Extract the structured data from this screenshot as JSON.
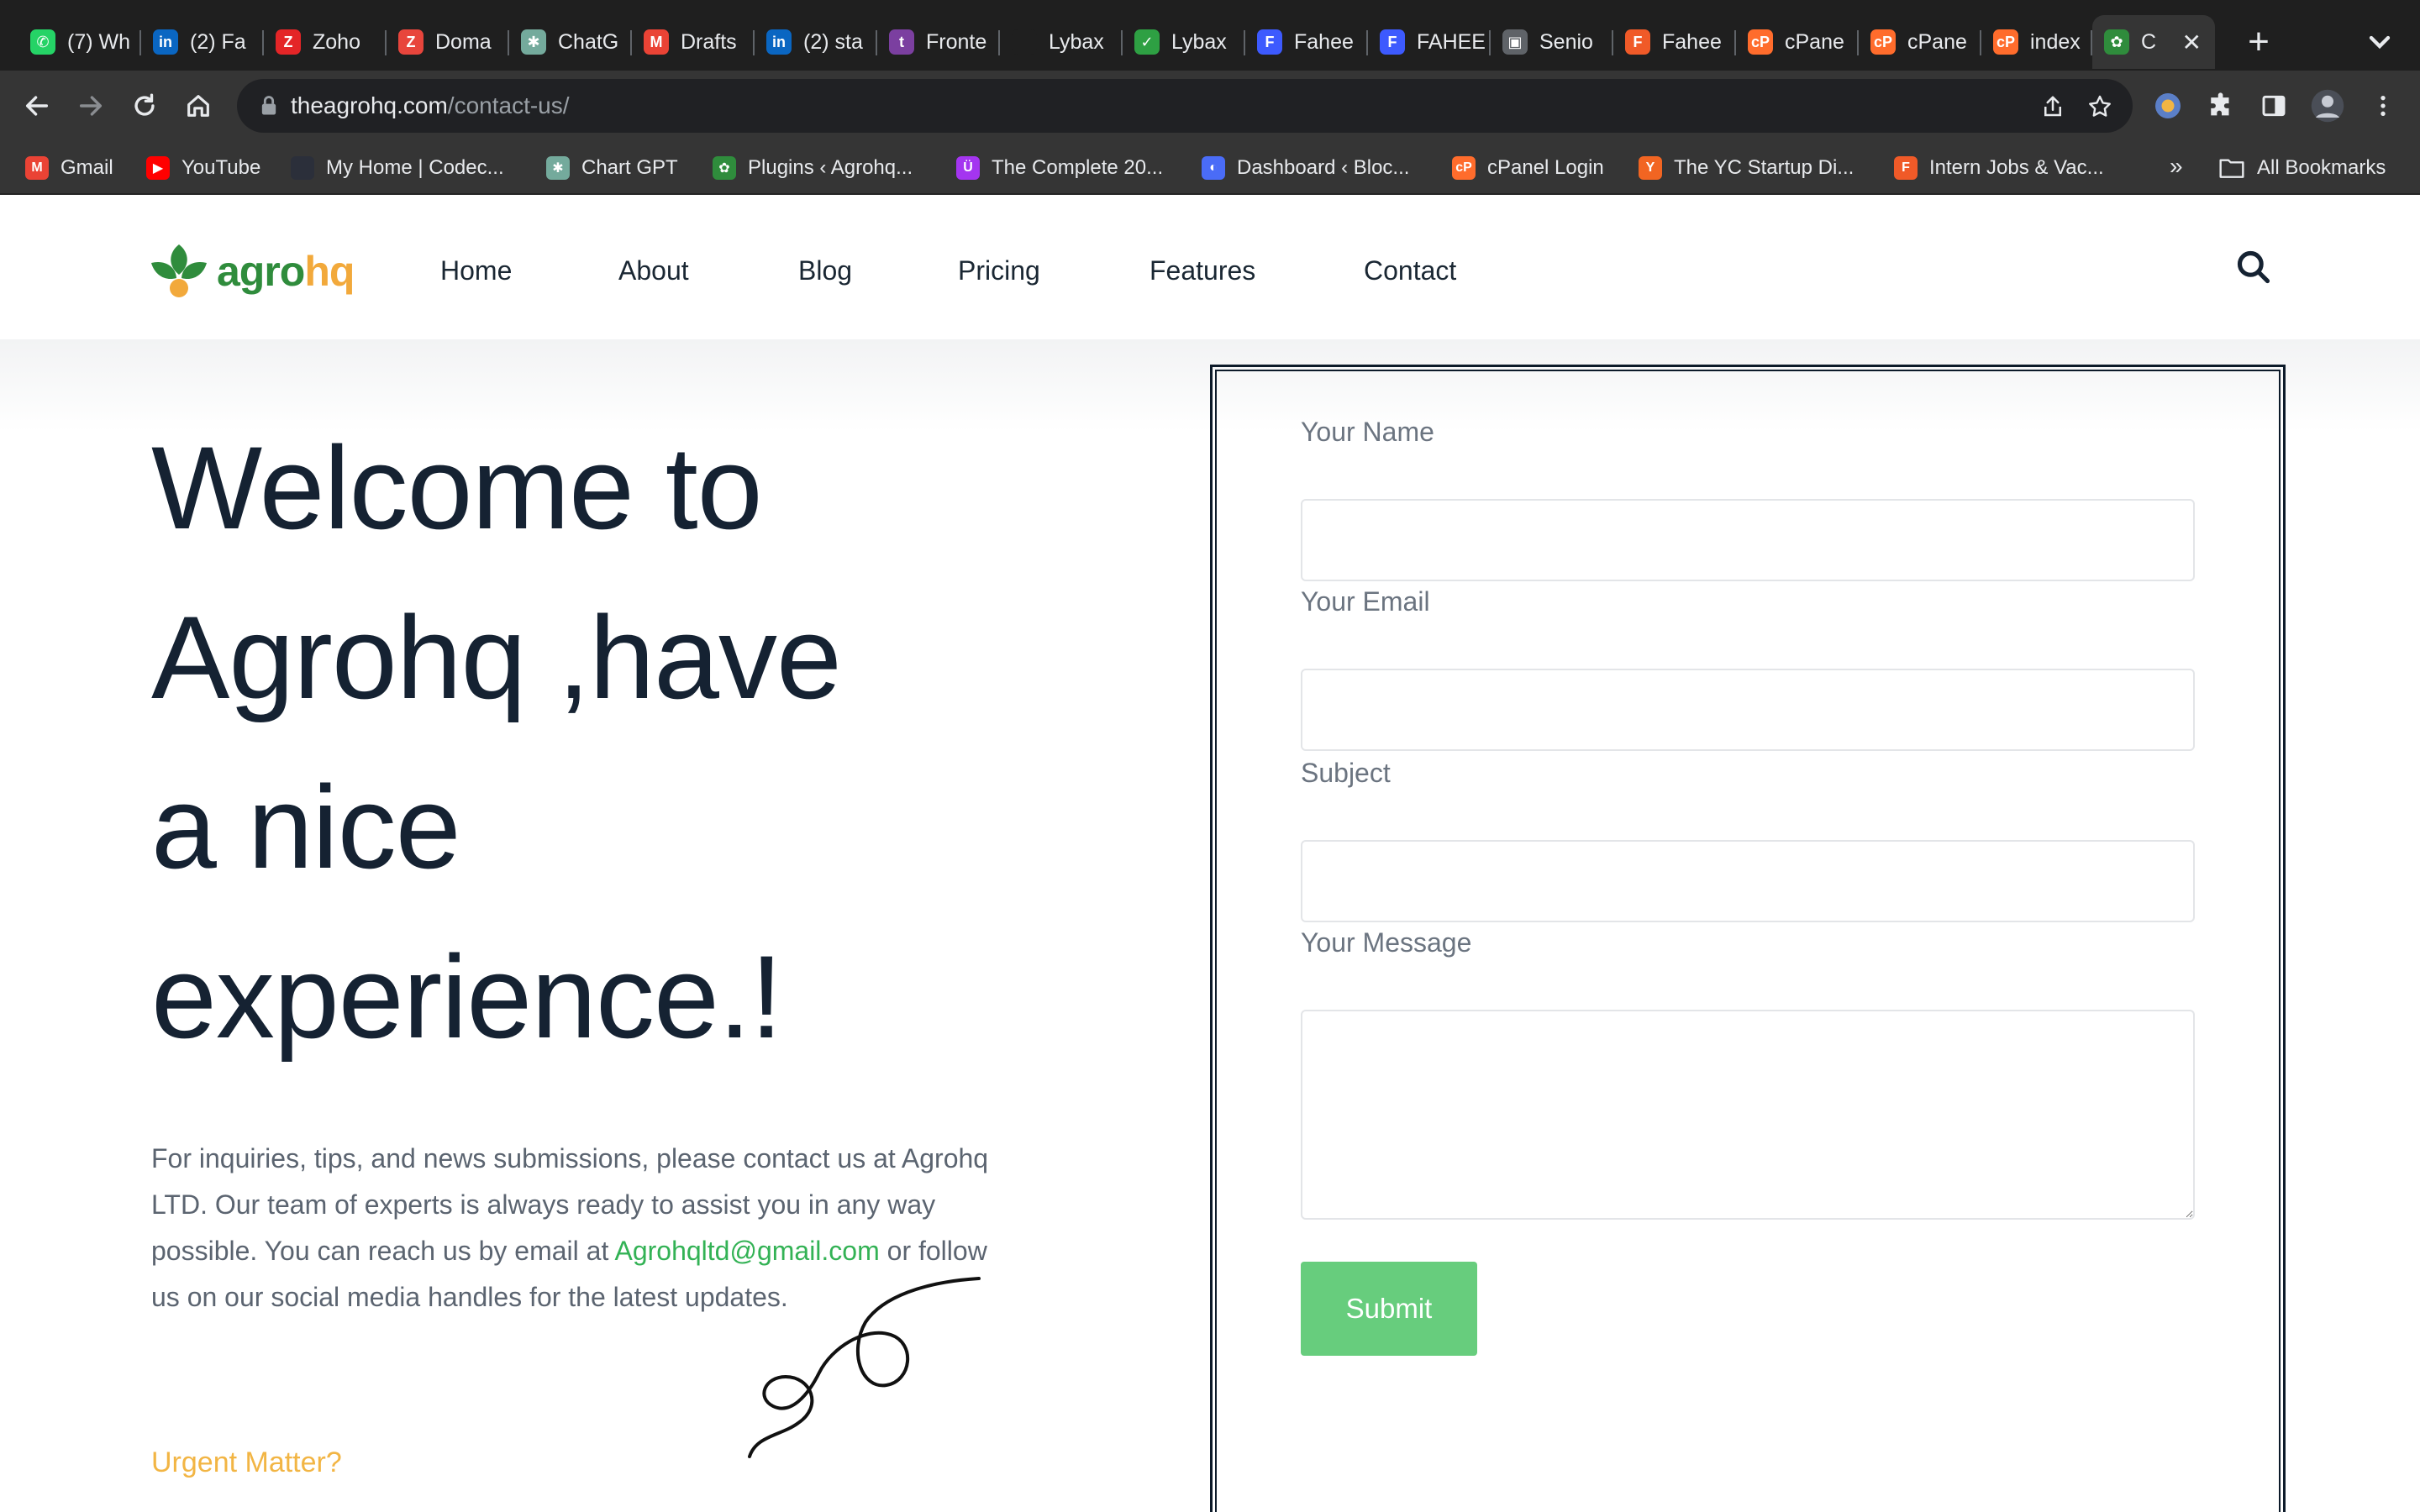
{
  "browser": {
    "tabs": [
      {
        "title": "(7) Wh",
        "icon": "whatsapp-icon",
        "color": "#25d366",
        "glyph": "✆"
      },
      {
        "title": "(2) Fa",
        "icon": "linkedin-icon",
        "color": "#0a66c2",
        "glyph": "in"
      },
      {
        "title": "Zoho",
        "icon": "zoho-icon",
        "color": "#e42527",
        "glyph": "Z"
      },
      {
        "title": "Doma",
        "icon": "domain-icon",
        "color": "#e8453c",
        "glyph": "Z"
      },
      {
        "title": "ChatG",
        "icon": "chatgpt-icon",
        "color": "#74aa9c",
        "glyph": "✱"
      },
      {
        "title": "Drafts",
        "icon": "gmail-icon",
        "color": "#ea4335",
        "glyph": "M"
      },
      {
        "title": "(2) sta",
        "icon": "linkedin-icon",
        "color": "#0a66c2",
        "glyph": "in"
      },
      {
        "title": "Fronte",
        "icon": "fronted-icon",
        "color": "#7b3fa0",
        "glyph": "t"
      },
      {
        "title": "Lybax",
        "icon": "blank-page-icon",
        "color": "#1f1f1f",
        "glyph": ""
      },
      {
        "title": "Lybax",
        "icon": "check-circle-icon",
        "color": "#2ea043",
        "glyph": "✓"
      },
      {
        "title": "Fahee",
        "icon": "fahee-icon",
        "color": "#3d5afe",
        "glyph": "F"
      },
      {
        "title": "FAHEE",
        "icon": "fahee-icon",
        "color": "#3d5afe",
        "glyph": "F"
      },
      {
        "title": "Senio",
        "icon": "senior-icon",
        "color": "#5f6368",
        "glyph": "▣"
      },
      {
        "title": "Fahee",
        "icon": "fbs-icon",
        "color": "#f05a28",
        "glyph": "F"
      },
      {
        "title": "cPane",
        "icon": "cpanel-icon",
        "color": "#ff6c2c",
        "glyph": "cP"
      },
      {
        "title": "cPane",
        "icon": "cpanel-icon",
        "color": "#ff6c2c",
        "glyph": "cP"
      },
      {
        "title": "index",
        "icon": "cpanel-icon",
        "color": "#ff6c2c",
        "glyph": "cP"
      },
      {
        "title": "C",
        "icon": "agrohq-icon",
        "color": "#2f8c3c",
        "glyph": "✿"
      }
    ],
    "new_tab_label": "+",
    "close_glyph": "✕",
    "url_host": "theagrohq.com",
    "url_path": "/contact-us/",
    "bookmarks": [
      {
        "label": "Gmail",
        "icon": "gmail-icon",
        "color": "#ea4335",
        "glyph": "M"
      },
      {
        "label": "YouTube",
        "icon": "youtube-icon",
        "color": "#ff0000",
        "glyph": "▶"
      },
      {
        "label": "My Home | Codec...",
        "icon": "codec-icon",
        "color": "#2b2f3a",
        "glyph": ""
      },
      {
        "label": "Chart GPT",
        "icon": "chatgpt-icon",
        "color": "#74aa9c",
        "glyph": "✱"
      },
      {
        "label": "Plugins ‹ Agrohq...",
        "icon": "agrohq-icon",
        "color": "#2f8c3c",
        "glyph": "✿"
      },
      {
        "label": "The Complete 20...",
        "icon": "udemy-icon",
        "color": "#a435f0",
        "glyph": "Ü"
      },
      {
        "label": "Dashboard ‹ Bloc...",
        "icon": "dashboard-icon",
        "color": "#4a6cf7",
        "glyph": "◐"
      },
      {
        "label": "cPanel Login",
        "icon": "cpanel-icon",
        "color": "#ff6c2c",
        "glyph": "cP"
      },
      {
        "label": "The YC Startup Di...",
        "icon": "ycombinator-icon",
        "color": "#f26522",
        "glyph": "Y"
      },
      {
        "label": "Intern Jobs & Vac...",
        "icon": "fbs-icon",
        "color": "#f05a28",
        "glyph": "F"
      }
    ],
    "bookmarks_more": "»",
    "all_bookmarks": "All Bookmarks"
  },
  "site": {
    "logo_part1": "agro",
    "logo_part2": "hq",
    "nav": [
      "Home",
      "About",
      "Blog",
      "Pricing",
      "Features",
      "Contact"
    ],
    "hero_line1": "Welcome to",
    "hero_highlight": "Agrohq",
    "hero_line2_rest": " ,have",
    "hero_line3": "a nice",
    "hero_line4": "experience.!",
    "intro_before_email": "For inquiries, tips, and news submissions, please contact us at Agrohq LTD. Our team of experts is always ready to assist you in any way possible. You can reach us by email at ",
    "intro_email": "Agrohqltd@gmail.com",
    "intro_after_email": " or follow us on our social media handles for the latest updates.",
    "urgent_heading": "Urgent Matter?"
  },
  "form": {
    "name_label": "Your Name",
    "name_value": "",
    "email_label": "Your Email",
    "email_value": "",
    "subject_label": "Subject",
    "subject_value": "",
    "message_label": "Your Message",
    "message_value": "",
    "submit_label": "Submit"
  },
  "colors": {
    "brand_green": "#2f8c3c",
    "brand_orange": "#f2a93b",
    "accent_green": "#67cd7d",
    "heading_navy": "#152232"
  }
}
